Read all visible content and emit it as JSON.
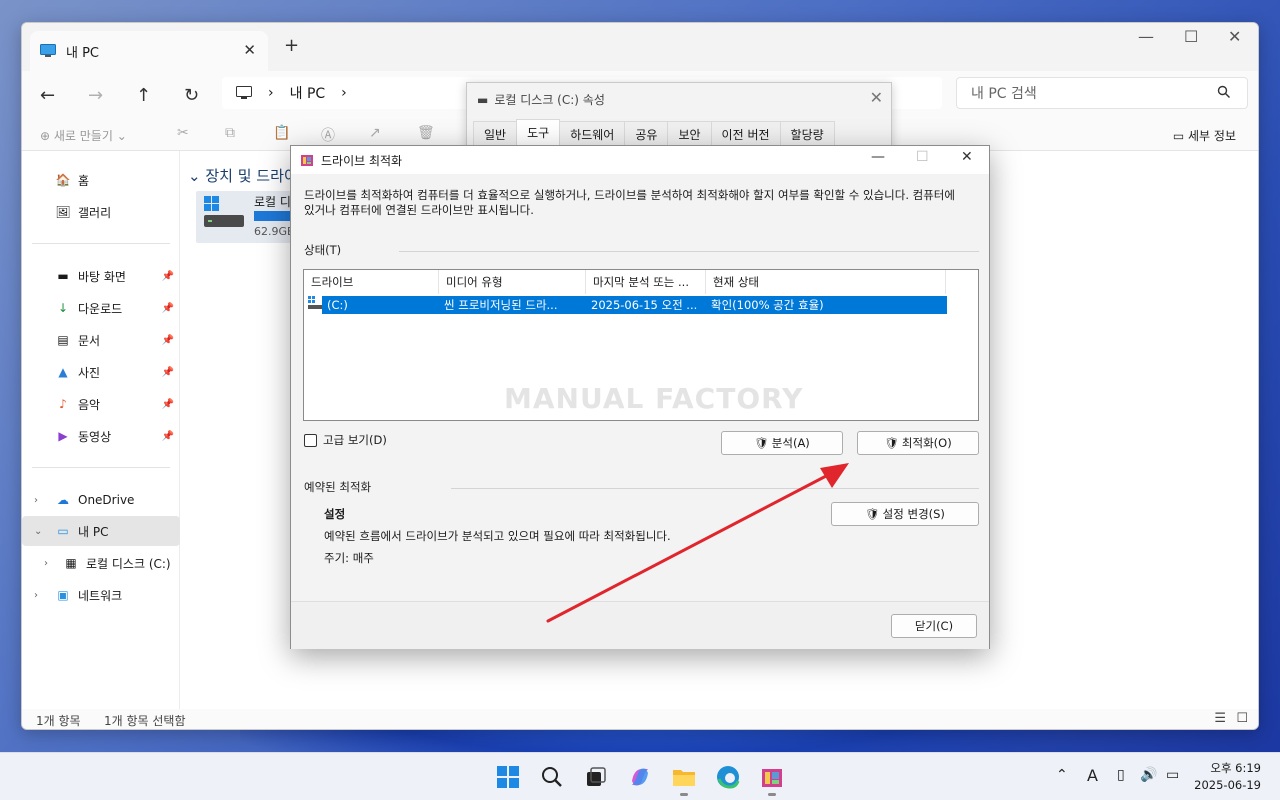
{
  "explorer": {
    "tab_title": "내 PC",
    "breadcrumb": [
      "내 PC"
    ],
    "search_placeholder": "내 PC 검색",
    "toolbar_new": "새로 만들기",
    "toolbar_details": "세부 정보",
    "group_header": "장치 및 드라이",
    "drive_name": "로컬 디",
    "drive_size": "62.9GB",
    "status_count": "1개 항목",
    "status_selected": "1개 항목 선택함"
  },
  "sidebar": {
    "quick": [
      {
        "label": "홈",
        "icon": "home-icon"
      },
      {
        "label": "갤러리",
        "icon": "gallery-icon"
      }
    ],
    "pinned": [
      {
        "label": "바탕 화면",
        "icon": "desktop-icon"
      },
      {
        "label": "다운로드",
        "icon": "download-icon"
      },
      {
        "label": "문서",
        "icon": "document-icon"
      },
      {
        "label": "사진",
        "icon": "pictures-icon"
      },
      {
        "label": "음악",
        "icon": "music-icon"
      },
      {
        "label": "동영상",
        "icon": "video-icon"
      }
    ],
    "tree": [
      {
        "label": "OneDrive",
        "icon": "cloud-icon"
      },
      {
        "label": "내 PC",
        "icon": "pc-icon"
      },
      {
        "label": "로컬 디스크 (C:)",
        "icon": "drive-icon"
      },
      {
        "label": "네트워크",
        "icon": "network-icon"
      }
    ]
  },
  "properties_dialog": {
    "title": "로컬 디스크 (C:) 속성",
    "tabs": [
      "일반",
      "도구",
      "하드웨어",
      "공유",
      "보안",
      "이전 버전",
      "할당량"
    ],
    "active_tab": "도구"
  },
  "optimize_dialog": {
    "title": "드라이브 최적화",
    "description": "드라이브를 최적화하여 컴퓨터를 더 효율적으로 실행하거나, 드라이브를 분석하여 최적화해야 할지 여부를 확인할 수 있습니다. 컴퓨터에 있거나 컴퓨터에 연결된 드라이브만 표시됩니다.",
    "status_label": "상태(T)",
    "columns": [
      "드라이브",
      "미디어 유형",
      "마지막 분석 또는 ...",
      "현재 상태"
    ],
    "rows": [
      {
        "drive": "(C:)",
        "media": "씬 프로비저닝된 드라...",
        "last": "2025-06-15 오전 ...",
        "state": "확인(100% 공간 효율)"
      }
    ],
    "watermark": "MANUAL FACTORY",
    "advanced_view": "고급 보기(D)",
    "analyze_button": "분석(A)",
    "optimize_button": "최적화(O)",
    "scheduled_label": "예약된 최적화",
    "settings_heading": "설정",
    "settings_text": "예약된 흐름에서 드라이브가 분석되고 있으며 필요에 따라 최적화됩니다.",
    "frequency_text": "주기: 매주",
    "change_settings_button": "설정 변경(S)",
    "close_button": "닫기(C)"
  },
  "taskbar": {
    "time": "오후 6:19",
    "date": "2025-06-19",
    "ime": "A"
  },
  "colors": {
    "selection": "#0078d7",
    "annotation_arrow": "#e0262c"
  }
}
